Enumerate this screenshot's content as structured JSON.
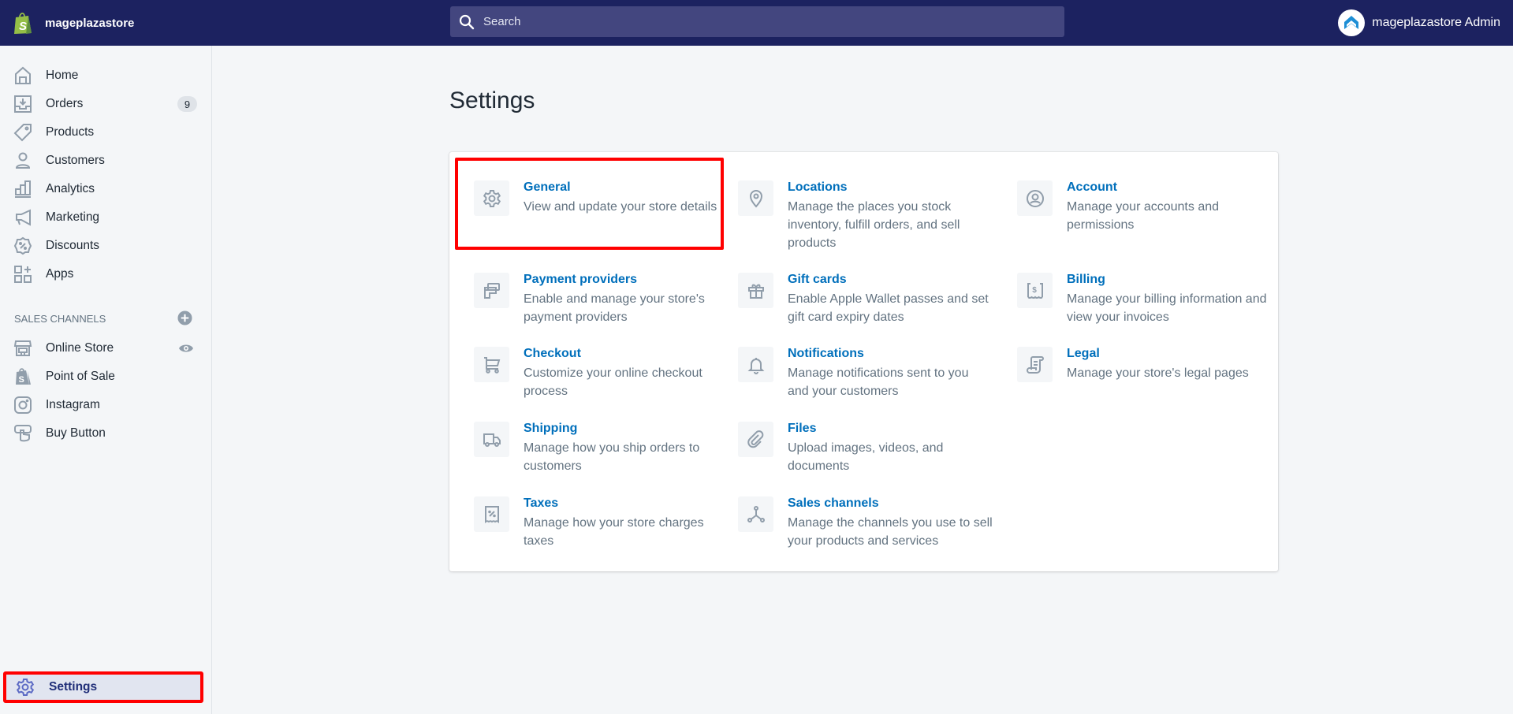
{
  "topbar": {
    "store_name": "mageplazastore",
    "search_placeholder": "Search",
    "user_name": "mageplazastore Admin",
    "colors": {
      "background": "#1c2260",
      "search_bg": "#43467f"
    }
  },
  "sidebar": {
    "items": [
      {
        "label": "Home",
        "icon": "home-icon"
      },
      {
        "label": "Orders",
        "icon": "orders-icon",
        "badge": "9"
      },
      {
        "label": "Products",
        "icon": "tag-icon"
      },
      {
        "label": "Customers",
        "icon": "person-icon"
      },
      {
        "label": "Analytics",
        "icon": "bar-chart-icon"
      },
      {
        "label": "Marketing",
        "icon": "megaphone-icon"
      },
      {
        "label": "Discounts",
        "icon": "discount-icon"
      },
      {
        "label": "Apps",
        "icon": "apps-icon"
      }
    ],
    "sales_channels_heading": "SALES CHANNELS",
    "channels": [
      {
        "label": "Online Store",
        "icon": "store-icon"
      },
      {
        "label": "Point of Sale",
        "icon": "shopping-bag-icon"
      },
      {
        "label": "Instagram",
        "icon": "instagram-icon"
      },
      {
        "label": "Buy Button",
        "icon": "buy-button-icon"
      }
    ],
    "settings_label": "Settings"
  },
  "main": {
    "title": "Settings",
    "settings": [
      {
        "title": "General",
        "description": "View and update your store details",
        "icon": "gear-icon"
      },
      {
        "title": "Locations",
        "description": "Manage the places you stock inventory, fulfill orders, and sell products",
        "icon": "location-pin-icon"
      },
      {
        "title": "Account",
        "description": "Manage your accounts and permissions",
        "icon": "account-icon"
      },
      {
        "title": "Payment providers",
        "description": "Enable and manage your store's payment providers",
        "icon": "payment-cards-icon"
      },
      {
        "title": "Gift cards",
        "description": "Enable Apple Wallet passes and set gift card expiry dates",
        "icon": "gift-icon"
      },
      {
        "title": "Billing",
        "description": "Manage your billing information and view your invoices",
        "icon": "billing-icon"
      },
      {
        "title": "Checkout",
        "description": "Customize your online checkout process",
        "icon": "cart-icon"
      },
      {
        "title": "Notifications",
        "description": "Manage notifications sent to you and your customers",
        "icon": "bell-icon"
      },
      {
        "title": "Legal",
        "description": "Manage your store's legal pages",
        "icon": "legal-scroll-icon"
      },
      {
        "title": "Shipping",
        "description": "Manage how you ship orders to customers",
        "icon": "truck-icon"
      },
      {
        "title": "Files",
        "description": "Upload images, videos, and documents",
        "icon": "paperclip-icon"
      },
      {
        "title": "Taxes",
        "description": "Manage how your store charges taxes",
        "icon": "tax-receipt-icon"
      },
      {
        "title": "Sales channels",
        "description": "Manage the channels you use to sell your products and services",
        "icon": "sales-channels-icon"
      }
    ],
    "colors": {
      "link": "#006fbb",
      "muted": "#637381",
      "highlight": "#ff0000"
    }
  }
}
